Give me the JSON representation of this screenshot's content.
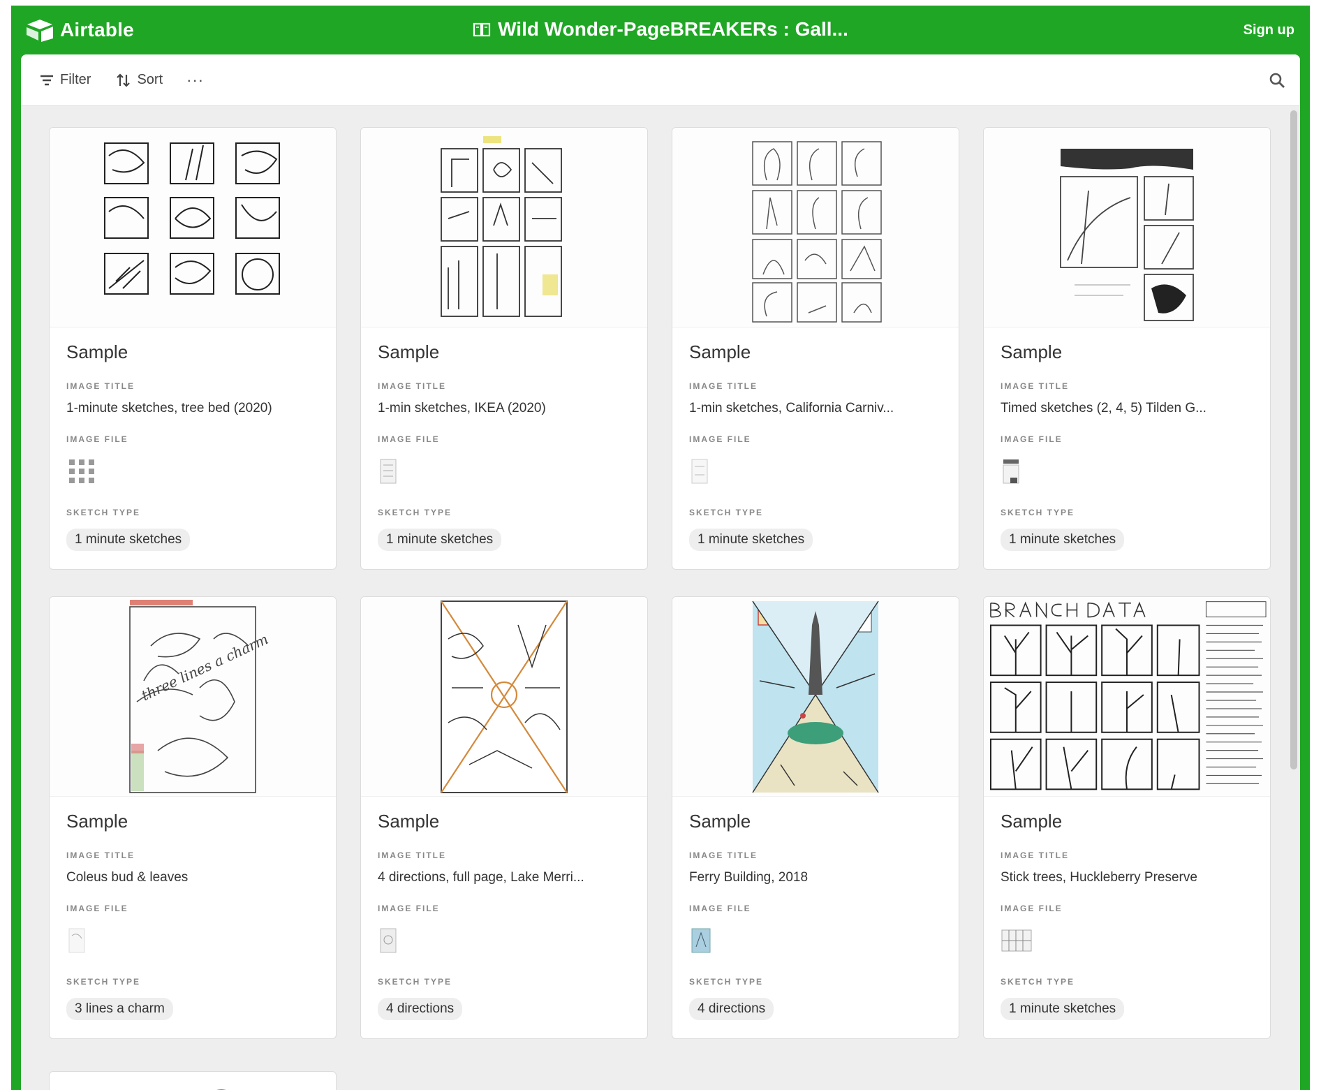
{
  "header": {
    "brand": "Airtable",
    "base_title": "Wild Wonder-PageBREAKERs : Gall...",
    "signup_label": "Sign up"
  },
  "toolbar": {
    "filter_label": "Filter",
    "sort_label": "Sort",
    "more_label": "···"
  },
  "cards": [
    {
      "name": "Sample",
      "image_title_label": "IMAGE TITLE",
      "image_title": "1-minute sketches, tree bed (2020)",
      "image_file_label": "IMAGE FILE",
      "sketch_type_label": "SKETCH TYPE",
      "sketch_type": "1 minute sketches"
    },
    {
      "name": "Sample",
      "image_title_label": "IMAGE TITLE",
      "image_title": "1-min sketches, IKEA (2020)",
      "image_file_label": "IMAGE FILE",
      "sketch_type_label": "SKETCH TYPE",
      "sketch_type": "1 minute sketches"
    },
    {
      "name": "Sample",
      "image_title_label": "IMAGE TITLE",
      "image_title": "1-min sketches, California Carniv...",
      "image_file_label": "IMAGE FILE",
      "sketch_type_label": "SKETCH TYPE",
      "sketch_type": "1 minute sketches"
    },
    {
      "name": "Sample",
      "image_title_label": "IMAGE TITLE",
      "image_title": "Timed sketches (2, 4, 5) Tilden G...",
      "image_file_label": "IMAGE FILE",
      "sketch_type_label": "SKETCH TYPE",
      "sketch_type": "1 minute sketches"
    },
    {
      "name": "Sample",
      "image_title_label": "IMAGE TITLE",
      "image_title": "Coleus bud & leaves",
      "image_file_label": "IMAGE FILE",
      "sketch_type_label": "SKETCH TYPE",
      "sketch_type": "3 lines a charm"
    },
    {
      "name": "Sample",
      "image_title_label": "IMAGE TITLE",
      "image_title": "4 directions, full page, Lake Merri...",
      "image_file_label": "IMAGE FILE",
      "sketch_type_label": "SKETCH TYPE",
      "sketch_type": "4 directions"
    },
    {
      "name": "Sample",
      "image_title_label": "IMAGE TITLE",
      "image_title": "Ferry Building, 2018",
      "image_file_label": "IMAGE FILE",
      "sketch_type_label": "SKETCH TYPE",
      "sketch_type": "4 directions"
    },
    {
      "name": "Sample",
      "image_title_label": "IMAGE TITLE",
      "image_title": "Stick trees, Huckleberry Preserve",
      "image_file_label": "IMAGE FILE",
      "sketch_type_label": "SKETCH TYPE",
      "sketch_type": "1 minute sketches"
    }
  ],
  "colors": {
    "brand_green": "#20a625",
    "panel_bg": "#eeeeee",
    "pill_bg": "#eeeeee"
  },
  "icons": [
    "airtable-logo-icon",
    "book-icon",
    "filter-icon",
    "sort-icon",
    "more-icon",
    "search-icon"
  ]
}
